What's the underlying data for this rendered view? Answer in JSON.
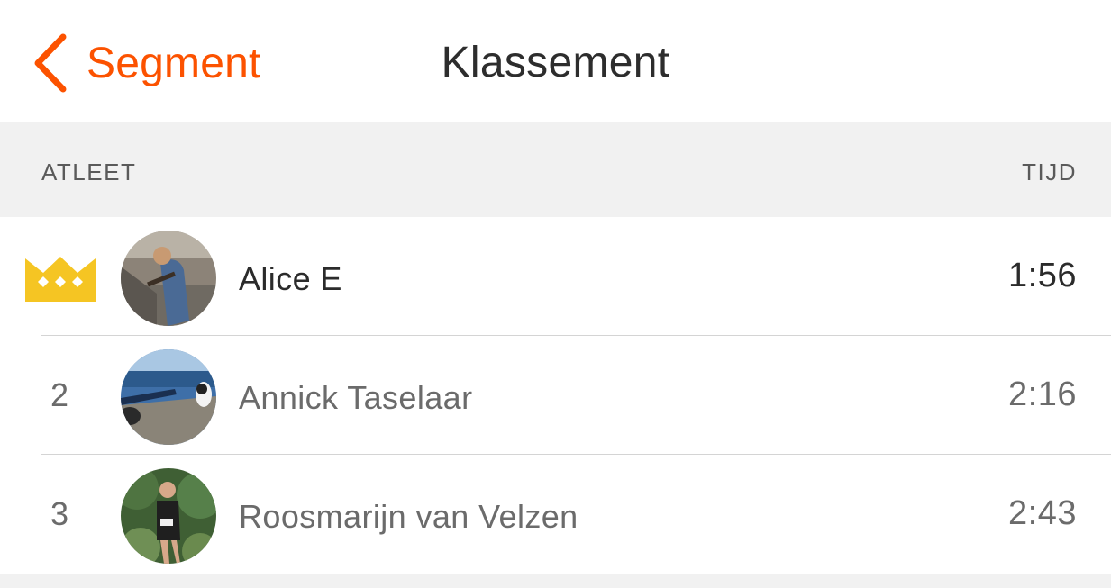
{
  "nav": {
    "back_label": "Segment",
    "title": "Klassement",
    "back_icon": "chevron-left-icon",
    "accent_color": "#fc5200"
  },
  "table": {
    "col_athlete": "ATLEET",
    "col_time": "TIJD"
  },
  "leaderboard": [
    {
      "rank": "",
      "rank_icon": "crown-icon",
      "name": "Alice E",
      "time": "1:56"
    },
    {
      "rank": "2",
      "name": "Annick Taselaar",
      "time": "2:16"
    },
    {
      "rank": "3",
      "name": "Roosmarijn van Velzen",
      "time": "2:43"
    }
  ]
}
